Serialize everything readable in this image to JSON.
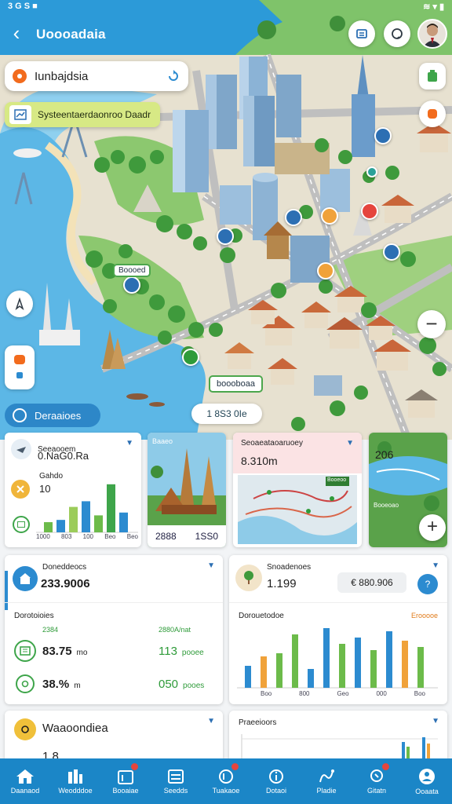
{
  "app": {
    "title": "Uoooadaia"
  },
  "status": {
    "left": "3 G S ■",
    "right": "≋ ▾ ▮"
  },
  "search": {
    "text": "Iunbajdsia"
  },
  "system_chip": {
    "text": "Systeentaerdaonroo Daadr"
  },
  "map": {
    "label_bottom": "boooboaa",
    "label_city": "Boooed",
    "destinations": "Deraaioes",
    "location_pill": "1 8S3 0Ie"
  },
  "cards": {
    "stats": {
      "title": "Seeaooem",
      "value": "0.NaG0.Ra",
      "sub": "Gahdo",
      "count": "10",
      "ticks": [
        "1000",
        "803",
        "100",
        "Beo",
        "Beo"
      ]
    },
    "photo1": {
      "title": "Baaeo",
      "left": "2888",
      "right": "1SS0"
    },
    "routes": {
      "title": "Seoaeataoaruoey",
      "value": "8.310m",
      "map_badge": "Booeoo"
    },
    "photo2": {
      "value": "206",
      "caption": "Booeoao"
    },
    "budget": {
      "title": "Doneddeocs",
      "value": "233.9006",
      "sub": "Dorotoioies",
      "a_label": "2384",
      "a_right": "2880A/nat",
      "row1_val": "83.75",
      "row1_unit": "mo",
      "row1_right": "113",
      "row1_right_unit": "pooee",
      "row2_val": "38.%",
      "row2_unit": "m",
      "row2_right": "050",
      "row2_right_unit": "pooes"
    },
    "overview": {
      "title": "Snoadenoes",
      "value": "1.199",
      "chip": "€ 880.906",
      "chart_title": "Dorouetodoe",
      "legend": "Erooooe",
      "ticks": [
        "Boo",
        "800",
        "Geo",
        "000",
        "Boo"
      ]
    },
    "bottom_left": {
      "title": "Waaoondiea",
      "value": "1.8"
    },
    "bottom_right": {
      "title": "Praeeioors"
    }
  },
  "nav": [
    {
      "label": "Daanaod",
      "icon": "home-icon",
      "badge": false
    },
    {
      "label": "Weodddoe",
      "icon": "city-icon",
      "badge": false
    },
    {
      "label": "Booaiae",
      "icon": "calendar-icon",
      "badge": true
    },
    {
      "label": "Seedds",
      "icon": "list-icon",
      "badge": false
    },
    {
      "label": "Tuakaoe",
      "icon": "globe-icon",
      "badge": true
    },
    {
      "label": "Dotaoi",
      "icon": "info-icon",
      "badge": false
    },
    {
      "label": "Pladie",
      "icon": "route-icon",
      "badge": false
    },
    {
      "label": "Gitatn",
      "icon": "pin-icon",
      "badge": true
    },
    {
      "label": "Ooaata",
      "icon": "user-icon",
      "badge": false
    }
  ],
  "colors": {
    "primary": "#1b86c7",
    "green": "#2f9b3a",
    "accent": "#d7e985",
    "water": "#5cb7e6"
  }
}
